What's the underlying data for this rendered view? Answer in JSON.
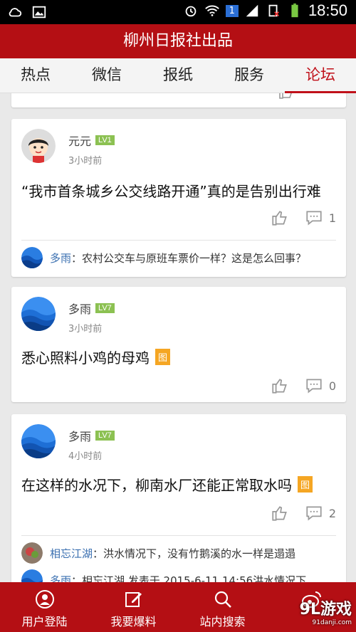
{
  "status_bar": {
    "time": "18:50",
    "sim_badge": "1"
  },
  "app_title": "柳州日报社出品",
  "tabs": [
    {
      "label": "热点"
    },
    {
      "label": "微信"
    },
    {
      "label": "报纸"
    },
    {
      "label": "服务"
    },
    {
      "label": "论坛",
      "active": true
    }
  ],
  "posts": [
    {
      "user": "元元",
      "level": "LV1",
      "time": "3小时前",
      "title": "“我市首条城乡公交线路开通”真的是告别出行难",
      "comments": "1",
      "replies": [
        {
          "name": "多雨",
          "text": "：农村公交车与原班车票价一样？这是怎么回事？"
        }
      ]
    },
    {
      "user": "多雨",
      "level": "LV7",
      "time": "3小时前",
      "title": "悉心照料小鸡的母鸡",
      "img_tag": "图",
      "comments": "0"
    },
    {
      "user": "多雨",
      "level": "LV7",
      "time": "4小时前",
      "title": "在这样的水况下，柳南水厂还能正常取水吗",
      "img_tag": "图",
      "comments": "2",
      "replies": [
        {
          "name": "相忘江湖",
          "text": "：洪水情况下，没有竹鹅溪的水一样是遢遢"
        },
        {
          "name": "多雨",
          "text": "：相忘江湖 发表于 2015-6-11 14:56洪水情况下"
        }
      ]
    }
  ],
  "bottom_nav": [
    {
      "label": "用户登陆",
      "icon": "user-icon"
    },
    {
      "label": "我要爆料",
      "icon": "edit-icon"
    },
    {
      "label": "站内搜索",
      "icon": "search-icon"
    },
    {
      "label": "",
      "icon": "weibo-icon"
    }
  ],
  "watermark": {
    "main": "9L游戏",
    "sub": "91danji.com"
  },
  "colors": {
    "brand_red": "#b40f14",
    "tab_active": "#c0111a",
    "level_badge": "#8cc152",
    "img_tag": "#f5a623",
    "reply_name": "#3a6fb0"
  }
}
